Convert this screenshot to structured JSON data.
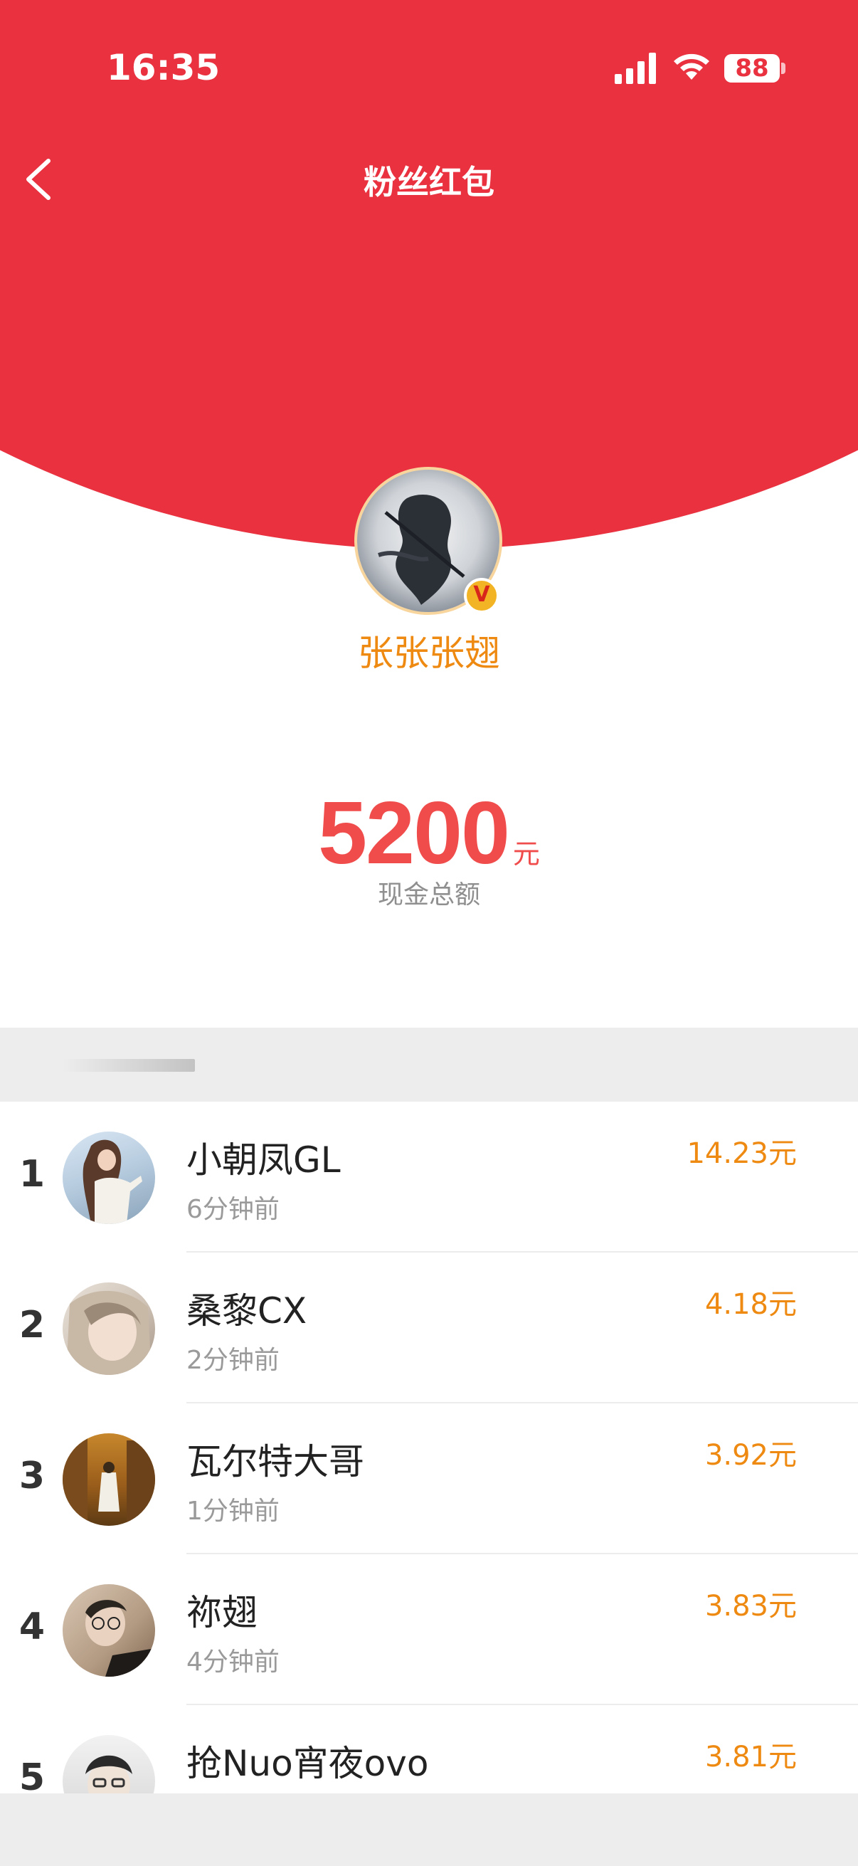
{
  "status_bar": {
    "time": "16:35",
    "battery": "88",
    "signal_icon": "cellular-signal-icon",
    "wifi_icon": "wifi-icon"
  },
  "nav": {
    "title": "粉丝红包",
    "back_icon": "chevron-left-icon"
  },
  "host": {
    "name": "张张张翅",
    "verified_badge": "V"
  },
  "amount": {
    "value": "5200",
    "unit": "元",
    "caption": "现金总额"
  },
  "recipients": [
    {
      "rank": "1",
      "name": "小朝凤GL",
      "time": "6分钟前",
      "amount": "14.23元"
    },
    {
      "rank": "2",
      "name": "桑黎CX",
      "time": "2分钟前",
      "amount": "4.18元"
    },
    {
      "rank": "3",
      "name": "瓦尔特大哥",
      "time": "1分钟前",
      "amount": "3.92元"
    },
    {
      "rank": "4",
      "name": "祢翅",
      "time": "4分钟前",
      "amount": "3.83元"
    },
    {
      "rank": "5",
      "name": "抢Nuo宵夜ovo",
      "time": "",
      "amount": "3.81元"
    }
  ],
  "colors": {
    "header_red": "#E9313F",
    "accent_orange": "#EE8A12",
    "amount_red": "#F04C4C"
  }
}
